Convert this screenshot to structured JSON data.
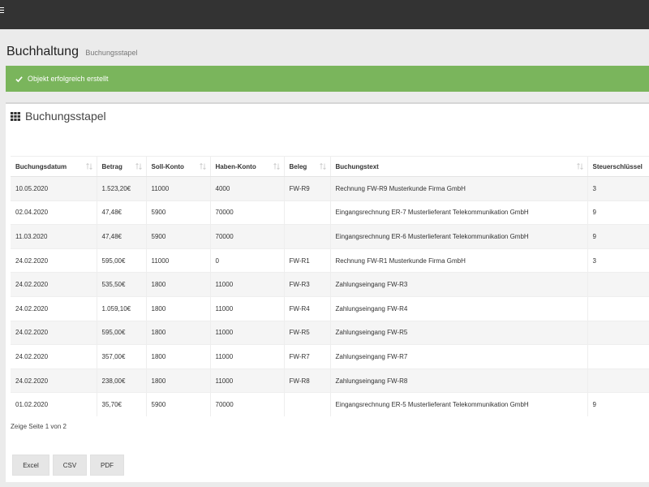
{
  "header": {
    "menu_icon": "hamburger-icon"
  },
  "page": {
    "title": "Buchhaltung",
    "subtitle": "Buchungsstapel"
  },
  "alert": {
    "icon": "check-icon",
    "message": "Objekt erfolgreich erstellt",
    "color": "#7ab55c"
  },
  "card": {
    "icon": "grid-icon",
    "title": "Buchungsstapel"
  },
  "table": {
    "columns": [
      "Buchungsdatum",
      "Betrag",
      "Soll-Konto",
      "Haben-Konto",
      "Beleg",
      "Buchungstext",
      "Steuerschlüssel"
    ],
    "rows": [
      [
        "10.05.2020",
        "1.523,20€",
        "11000",
        "4000",
        "FW-R9",
        "Rechnung FW-R9 Musterkunde Firma GmbH",
        "3"
      ],
      [
        "02.04.2020",
        "47,48€",
        "5900",
        "70000",
        "",
        "Eingangsrechnung ER-7 Musterlieferant Telekommunikation GmbH",
        "9"
      ],
      [
        "11.03.2020",
        "47,48€",
        "5900",
        "70000",
        "",
        "Eingangsrechnung ER-6 Musterlieferant Telekommunikation GmbH",
        "9"
      ],
      [
        "24.02.2020",
        "595,00€",
        "11000",
        "0",
        "FW-R1",
        "Rechnung FW-R1 Musterkunde Firma GmbH",
        "3"
      ],
      [
        "24.02.2020",
        "535,50€",
        "1800",
        "11000",
        "FW-R3",
        "Zahlungseingang FW-R3",
        ""
      ],
      [
        "24.02.2020",
        "1.059,10€",
        "1800",
        "11000",
        "FW-R4",
        "Zahlungseingang FW-R4",
        ""
      ],
      [
        "24.02.2020",
        "595,00€",
        "1800",
        "11000",
        "FW-R5",
        "Zahlungseingang FW-R5",
        ""
      ],
      [
        "24.02.2020",
        "357,00€",
        "1800",
        "11000",
        "FW-R7",
        "Zahlungseingang FW-R7",
        ""
      ],
      [
        "24.02.2020",
        "238,00€",
        "1800",
        "11000",
        "FW-R8",
        "Zahlungseingang FW-R8",
        ""
      ],
      [
        "01.02.2020",
        "35,70€",
        "5900",
        "70000",
        "",
        "Eingangsrechnung ER-5 Musterlieferant Telekommunikation GmbH",
        "9"
      ]
    ]
  },
  "pager": {
    "text": "Zeige Seite 1 von 2"
  },
  "export": {
    "excel": "Excel",
    "csv": "CSV",
    "pdf": "PDF"
  }
}
